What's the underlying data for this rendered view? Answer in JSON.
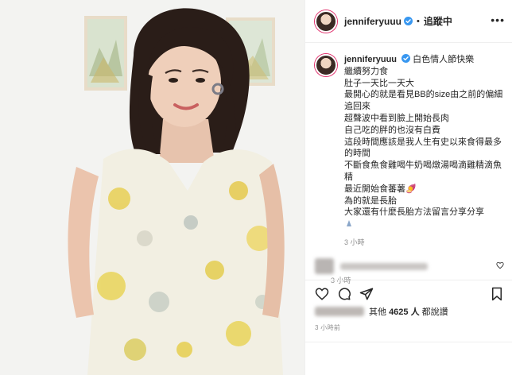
{
  "post": {
    "username": "jenniferyuuu",
    "follow_status": "追蹤中",
    "separator": "•",
    "more_label": "•••",
    "caption_first": "白色情人節快樂",
    "caption_lines": [
      "繼續努力食",
      "肚子一天比一天大",
      "最開心的就是看見BB的size由之前的偏細追回來",
      "超聲波中看到臉上開始長肉",
      "自己吃的胖的也沒有白費",
      "這段時間應該是我人生有史以來食得最多的時間",
      "不斷食魚食雞喝牛奶喝燉湯喝滴雞精滴魚精",
      "最近開始食蕃薯",
      "為的就是長胎",
      "大家還有什麼長胎方法留言分享分享"
    ],
    "sweet_potato_emoji": "🍠",
    "caption_time": "3 小時",
    "comment_time": "3 小時",
    "likes_prefix": "其他",
    "likes_count": "4625 人",
    "likes_suffix": "都說讚",
    "post_time": "3 小時前"
  },
  "icons": {
    "verified": "verified-badge-icon",
    "heart": "heart-icon",
    "comment": "comment-icon",
    "share": "share-icon",
    "bookmark": "bookmark-icon",
    "more": "more-options-icon"
  },
  "colors": {
    "verified_blue": "#3897f0",
    "text": "#262626",
    "muted": "#8e8e8e",
    "divider": "#efefef"
  }
}
